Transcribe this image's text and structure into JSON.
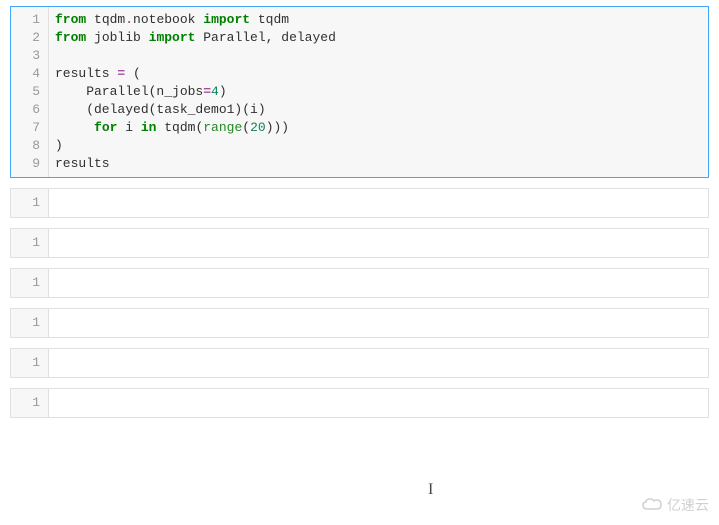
{
  "main_cell": {
    "line_numbers": [
      "1",
      "2",
      "3",
      "4",
      "5",
      "6",
      "7",
      "8",
      "9"
    ],
    "tokens": [
      [
        {
          "cls": "kw",
          "t": "from"
        },
        {
          "cls": "plain",
          "t": " tqdm"
        },
        {
          "cls": "op",
          "t": "."
        },
        {
          "cls": "plain",
          "t": "notebook "
        },
        {
          "cls": "kw",
          "t": "import"
        },
        {
          "cls": "plain",
          "t": " tqdm"
        }
      ],
      [
        {
          "cls": "kw",
          "t": "from"
        },
        {
          "cls": "plain",
          "t": " joblib "
        },
        {
          "cls": "kw",
          "t": "import"
        },
        {
          "cls": "plain",
          "t": " Parallel, delayed"
        }
      ],
      [],
      [
        {
          "cls": "plain",
          "t": "results "
        },
        {
          "cls": "op",
          "t": "="
        },
        {
          "cls": "plain",
          "t": " ("
        }
      ],
      [
        {
          "cls": "plain",
          "t": "    Parallel(n_jobs"
        },
        {
          "cls": "op",
          "t": "="
        },
        {
          "cls": "num",
          "t": "4"
        },
        {
          "cls": "plain",
          "t": ")"
        }
      ],
      [
        {
          "cls": "plain",
          "t": "    (delayed(task_demo1)(i)"
        }
      ],
      [
        {
          "cls": "plain",
          "t": "     "
        },
        {
          "cls": "kw",
          "t": "for"
        },
        {
          "cls": "plain",
          "t": " i "
        },
        {
          "cls": "kw",
          "t": "in"
        },
        {
          "cls": "plain",
          "t": " tqdm("
        },
        {
          "cls": "fn",
          "t": "range"
        },
        {
          "cls": "plain",
          "t": "("
        },
        {
          "cls": "num",
          "t": "20"
        },
        {
          "cls": "plain",
          "t": ")))"
        }
      ],
      [
        {
          "cls": "plain",
          "t": ")"
        }
      ],
      [
        {
          "cls": "plain",
          "t": "results"
        }
      ]
    ]
  },
  "empty_cells": [
    {
      "line": "1"
    },
    {
      "line": "1"
    },
    {
      "line": "1"
    },
    {
      "line": "1"
    },
    {
      "line": "1"
    },
    {
      "line": "1"
    }
  ],
  "watermark": "亿速云",
  "cursor_glyph": "I"
}
